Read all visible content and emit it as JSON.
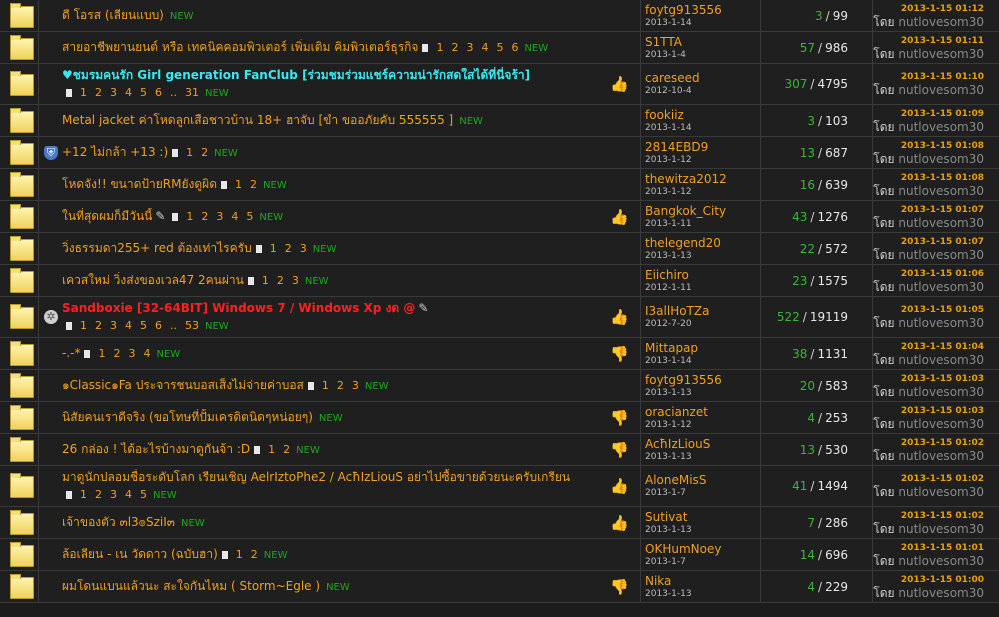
{
  "labels": {
    "by": "โดย",
    "new": "NEW",
    "ellipsis": ".."
  },
  "colors": {
    "title": "#f0a020",
    "cyan_title": "#38e8f0",
    "red_title": "#ff2020",
    "replies": "#3cb43c",
    "new": "#1fa81f"
  },
  "threads": [
    {
      "title": "ดี โอรส (เลียนแบบ)",
      "style": "normal",
      "type_icon": "",
      "mood": "",
      "pages": [],
      "new": true,
      "author": "foytg913556",
      "adate": "2013-1-14",
      "replies": "3",
      "views": "99",
      "last_date": "2013-1-15 01:12",
      "last_user": "nutlovesom30"
    },
    {
      "title": "สายอาชีพยานยนต์ หรือ เทคนิคคอมพิวเตอร์ เพิ่มเติม คิมพิวเตอร์ธุรกิจ",
      "style": "normal",
      "type_icon": "",
      "mood": "",
      "pages": [
        "1",
        "2",
        "3",
        "4",
        "5",
        "6"
      ],
      "new": true,
      "author": "S1TTA",
      "adate": "2013-1-4",
      "replies": "57",
      "views": "986",
      "last_date": "2013-1-15 01:11",
      "last_user": "nutlovesom30"
    },
    {
      "title": "♥ชมรมคนรัก Girl generation FanClub [ร่วมชมร่วมแชร์ความน่ารักสดใสได้ที่นี่จร้า]",
      "style": "cyan",
      "type_icon": "",
      "mood": "thumb-up",
      "pages": [
        "1",
        "2",
        "3",
        "4",
        "5",
        "6",
        "..",
        "31"
      ],
      "new": true,
      "author": "careseed",
      "adate": "2012-10-4",
      "replies": "307",
      "views": "4795",
      "last_date": "2013-1-15 01:10",
      "last_user": "nutlovesom30"
    },
    {
      "title": "Metal jacket ค่าโหดลูกเสือชาวบ้าน 18+ ฮาจับ [ขำ ขออภัยคับ 555555 ]",
      "style": "normal",
      "type_icon": "",
      "mood": "",
      "pages": [],
      "new": true,
      "author": "fookiiz",
      "adate": "2013-1-14",
      "replies": "3",
      "views": "103",
      "last_date": "2013-1-15 01:09",
      "last_user": "nutlovesom30"
    },
    {
      "title": "+12 ไม่กล้า +13 :)",
      "style": "normal",
      "type_icon": "shield",
      "mood": "",
      "pages": [
        "1",
        "2"
      ],
      "new": true,
      "author": "2814EBD9",
      "adate": "2013-1-12",
      "replies": "13",
      "views": "687",
      "last_date": "2013-1-15 01:08",
      "last_user": "nutlovesom30"
    },
    {
      "title": "โหดจัง!! ขนาดป้ายRMยังดูผิด",
      "style": "normal",
      "type_icon": "",
      "mood": "",
      "pages": [
        "1",
        "2"
      ],
      "new": true,
      "author": "thewitza2012",
      "adate": "2013-1-12",
      "replies": "16",
      "views": "639",
      "last_date": "2013-1-15 01:08",
      "last_user": "nutlovesom30"
    },
    {
      "title": "ในที่สุดผมก็มีวันนี้",
      "style": "normal",
      "type_icon": "",
      "mood": "thumb-up",
      "clip": true,
      "pages": [
        "1",
        "2",
        "3",
        "4",
        "5"
      ],
      "new": true,
      "author": "Bangkok_City",
      "adate": "2013-1-11",
      "replies": "43",
      "views": "1276",
      "last_date": "2013-1-15 01:07",
      "last_user": "nutlovesom30"
    },
    {
      "title": "วิ่งธรรมดา255+ red ต้องเท่าไรครับ",
      "style": "normal",
      "type_icon": "",
      "mood": "",
      "pages": [
        "1",
        "2",
        "3"
      ],
      "new": true,
      "author": "thelegend20",
      "adate": "2013-1-13",
      "replies": "22",
      "views": "572",
      "last_date": "2013-1-15 01:07",
      "last_user": "nutlovesom30"
    },
    {
      "title": "เควสใหม่ วิ่งส่งของเวล47 2คนผ่าน",
      "style": "normal",
      "type_icon": "",
      "mood": "",
      "pages": [
        "1",
        "2",
        "3"
      ],
      "new": true,
      "author": "Eiichiro",
      "adate": "2012-1-11",
      "replies": "23",
      "views": "1575",
      "last_date": "2013-1-15 01:06",
      "last_user": "nutlovesom30"
    },
    {
      "title": "Sandboxie [32-64BIT] Windows 7 / Windows Xp งด @",
      "style": "red",
      "type_icon": "gear",
      "mood": "thumb-up",
      "clip": true,
      "pages": [
        "1",
        "2",
        "3",
        "4",
        "5",
        "6",
        "..",
        "53"
      ],
      "new": true,
      "author": "I3allHoTZa",
      "adate": "2012-7-20",
      "replies": "522",
      "views": "19119",
      "last_date": "2013-1-15 01:05",
      "last_user": "nutlovesom30"
    },
    {
      "title": "-.-*",
      "style": "normal",
      "type_icon": "",
      "mood": "thumb-down",
      "pages": [
        "1",
        "2",
        "3",
        "4"
      ],
      "new": true,
      "author": "Mittapap",
      "adate": "2013-1-14",
      "replies": "38",
      "views": "1131",
      "last_date": "2013-1-15 01:04",
      "last_user": "nutlovesom30"
    },
    {
      "title": "๑Classic๑Fa ประจารชนบอสเส็งไม่จ่ายค่าบอส",
      "style": "normal",
      "type_icon": "",
      "mood": "",
      "pages": [
        "1",
        "2",
        "3"
      ],
      "new": true,
      "author": "foytg913556",
      "adate": "2013-1-13",
      "replies": "20",
      "views": "583",
      "last_date": "2013-1-15 01:03",
      "last_user": "nutlovesom30"
    },
    {
      "title": "นิสัยคนเราดีจริง (ขอโทษที่ปั้มเครดิตนิดๆหน่อยๆ)",
      "style": "normal",
      "type_icon": "",
      "mood": "thumb-down",
      "pages": [],
      "new": true,
      "author": "oracianzet",
      "adate": "2013-1-12",
      "replies": "4",
      "views": "253",
      "last_date": "2013-1-15 01:03",
      "last_user": "nutlovesom30"
    },
    {
      "title": "26 กล่อง ! ได้อะไรบ้างมาดูกันจ้า :D",
      "style": "normal",
      "type_icon": "",
      "mood": "thumb-down",
      "pages": [
        "1",
        "2"
      ],
      "new": true,
      "author": "AcħIzLiouS",
      "adate": "2013-1-13",
      "replies": "13",
      "views": "530",
      "last_date": "2013-1-15 01:02",
      "last_user": "nutlovesom30"
    },
    {
      "title": "มาดูนักปลอมชื่อระดับโลก เรียนเชิญ AelrIztoPhe2 / AcħIzLiouS อย่าไปซื้อขายด้วยนะครับเกรียน",
      "style": "normal",
      "type_icon": "",
      "mood": "thumb-up",
      "pages": [
        "1",
        "2",
        "3",
        "4",
        "5"
      ],
      "new": true,
      "author": "AloneMisS",
      "adate": "2013-1-7",
      "replies": "41",
      "views": "1494",
      "last_date": "2013-1-15 01:02",
      "last_user": "nutlovesom30"
    },
    {
      "title": "เจ้าของตัว ๓l3๏SziI๓",
      "style": "normal",
      "type_icon": "",
      "mood": "thumb-up",
      "pages": [],
      "new": true,
      "author": "Sutivat",
      "adate": "2013-1-13",
      "replies": "7",
      "views": "286",
      "last_date": "2013-1-15 01:02",
      "last_user": "nutlovesom30"
    },
    {
      "title": "ล้อเลียน - เน วัดดาว (ฉบับฮา)",
      "style": "normal",
      "type_icon": "",
      "mood": "",
      "pages": [
        "1",
        "2"
      ],
      "new": true,
      "author": "OKHumNoey",
      "adate": "2013-1-7",
      "replies": "14",
      "views": "696",
      "last_date": "2013-1-15 01:01",
      "last_user": "nutlovesom30"
    },
    {
      "title": "ผมโดนแบนแล้วนะ สะใจกันไหม ( Storm~Egle )",
      "style": "normal",
      "type_icon": "",
      "mood": "thumb-down",
      "pages": [],
      "new": true,
      "author": "Nika",
      "adate": "2013-1-13",
      "replies": "4",
      "views": "229",
      "last_date": "2013-1-15 01:00",
      "last_user": "nutlovesom30"
    }
  ]
}
